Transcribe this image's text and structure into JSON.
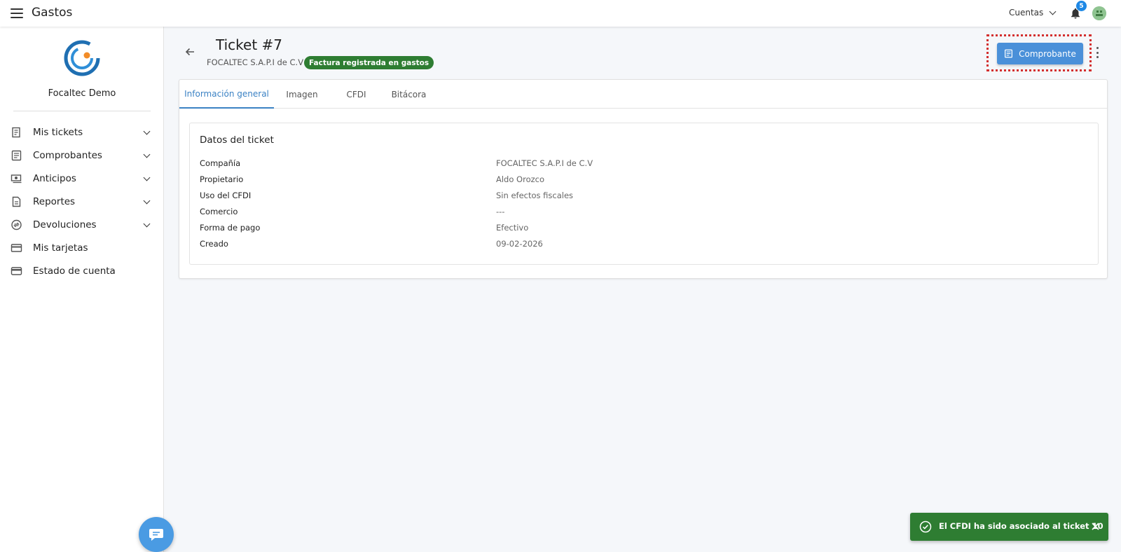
{
  "app": {
    "title": "Gastos"
  },
  "topbar": {
    "accounts_label": "Cuentas",
    "notification_count": "5"
  },
  "sidebar": {
    "org_name": "Focaltec Demo",
    "items": [
      {
        "label": "Mis tickets",
        "icon": "receipt-icon",
        "expandable": true
      },
      {
        "label": "Comprobantes",
        "icon": "document-icon",
        "expandable": true
      },
      {
        "label": "Anticipos",
        "icon": "cash-icon",
        "expandable": true
      },
      {
        "label": "Reportes",
        "icon": "report-icon",
        "expandable": true
      },
      {
        "label": "Devoluciones",
        "icon": "refund-icon",
        "expandable": true
      },
      {
        "label": "Mis tarjetas",
        "icon": "credit-card-icon",
        "expandable": false
      },
      {
        "label": "Estado de cuenta",
        "icon": "wallet-icon",
        "expandable": false
      }
    ]
  },
  "header": {
    "title": "Ticket #7",
    "company": "FOCALTEC S.A.P.I de C.V",
    "status": "Factura registrada en gastos",
    "comprobante_label": "Comprobante"
  },
  "tabs": [
    "Información general",
    "Imagen",
    "CFDI",
    "Bitácora"
  ],
  "details": {
    "title": "Datos del ticket",
    "rows": [
      {
        "label": "Compañía",
        "value": "FOCALTEC S.A.P.I de C.V"
      },
      {
        "label": "Propietario",
        "value": "Aldo Orozco"
      },
      {
        "label": "Uso del CFDI",
        "value": "Sin efectos fiscales"
      },
      {
        "label": "Comercio",
        "value": "---"
      },
      {
        "label": "Forma de pago",
        "value": "Efectivo"
      },
      {
        "label": "Creado",
        "value": "09-02-2026"
      }
    ]
  },
  "toast": {
    "message": "El CFDI ha sido asociado al ticket 10"
  },
  "colors": {
    "primary": "#4a90d9",
    "success": "#2e7d32",
    "highlight": "#d32f2f",
    "tab_active": "#3b82c4"
  }
}
